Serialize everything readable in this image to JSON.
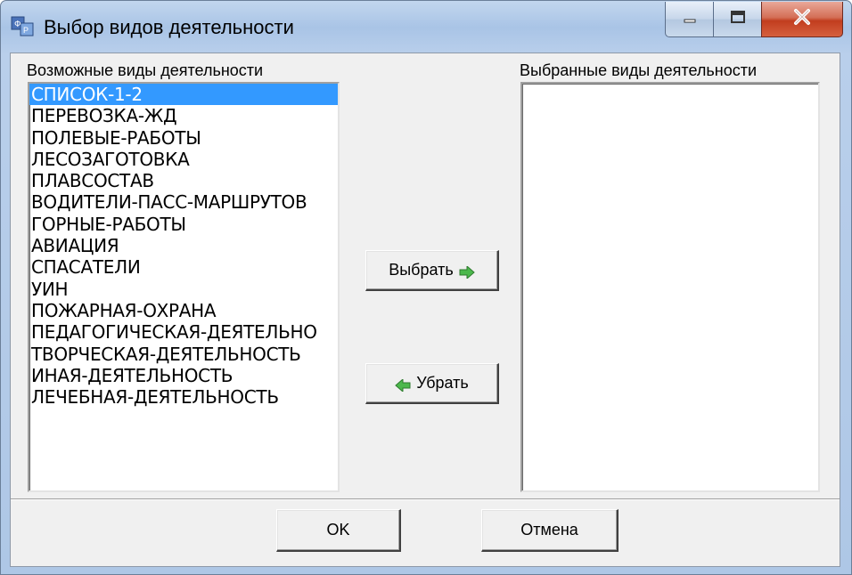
{
  "window": {
    "title": "Выбор видов деятельности",
    "icon": "app-icon",
    "minimize_icon": "minimize-icon",
    "maximize_icon": "maximize-icon",
    "close_icon": "close-icon"
  },
  "left_list": {
    "label": "Возможные виды деятельности",
    "selected_index": 0,
    "items": [
      "СПИСОК-1-2",
      "ПЕРЕВОЗКА-ЖД",
      "ПОЛЕВЫЕ-РАБОТЫ",
      "ЛЕСОЗАГОТОВКА",
      "ПЛАВСОСТАВ",
      "ВОДИТЕЛИ-ПАСС-МАРШРУТОВ",
      "ГОРНЫЕ-РАБОТЫ",
      "АВИАЦИЯ",
      "СПАСАТЕЛИ",
      "УИН",
      "ПОЖАРНАЯ-ОХРАНА",
      "ПЕДАГОГИЧЕСКАЯ-ДЕЯТЕЛЬНО",
      "ТВОРЧЕСКАЯ-ДЕЯТЕЛЬНОСТЬ",
      "ИНАЯ-ДЕЯТЕЛЬНОСТЬ",
      "ЛЕЧЕБНАЯ-ДЕЯТЕЛЬНОСТЬ"
    ]
  },
  "right_list": {
    "label": "Выбранные виды деятельности",
    "items": []
  },
  "buttons": {
    "select": "Выбрать",
    "remove": "Убрать",
    "ok": "OK",
    "cancel": "Отмена"
  },
  "colors": {
    "selection": "#3399ff",
    "arrow_green": "#2e9c2e",
    "close_red": "#c23d1e"
  }
}
